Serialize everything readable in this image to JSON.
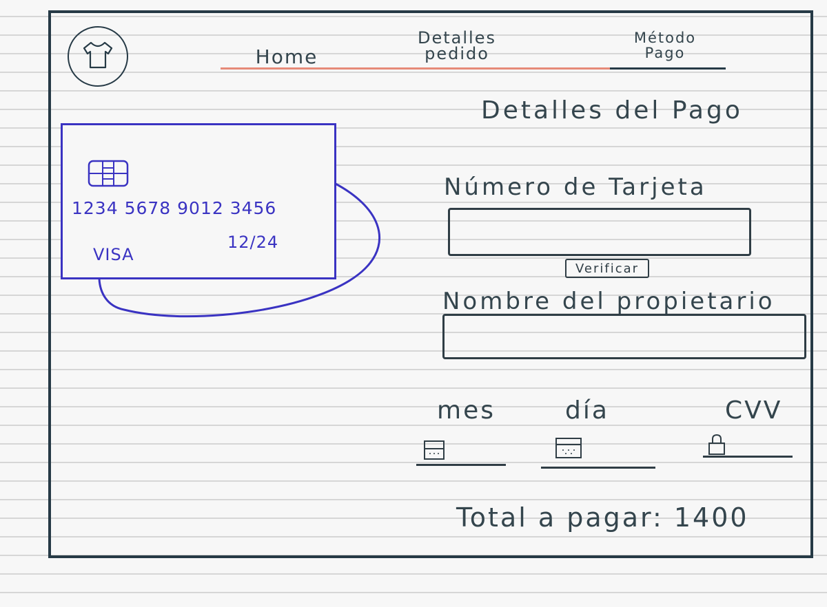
{
  "nav": {
    "home": "Home",
    "detalles_line1": "Detalles",
    "detalles_line2": "pedido",
    "metodo_line1": "Método",
    "metodo_line2": "Pago"
  },
  "logo_icon": "tshirt-icon",
  "card": {
    "number": "1234 5678 9012 3456",
    "brand": "VISA",
    "expiry": "12/24",
    "chip_icon": "card-chip-icon",
    "accent_color": "#3a33c2"
  },
  "form": {
    "title": "Detalles del Pago",
    "card_number_label": "Número de Tarjeta",
    "card_number_value": "",
    "verify_label": "Verificar",
    "owner_label": "Nombre del propietario",
    "owner_value": "",
    "month_label": "mes",
    "day_label": "día",
    "cvv_label": "CVV",
    "month_icon": "calendar-icon",
    "day_icon": "calendar-icon",
    "cvv_icon": "lock-icon"
  },
  "total": "Total a pagar: 1400",
  "colors": {
    "ink": "#2f3d45",
    "frame": "#263a46",
    "nav_active": "#e68a78"
  }
}
